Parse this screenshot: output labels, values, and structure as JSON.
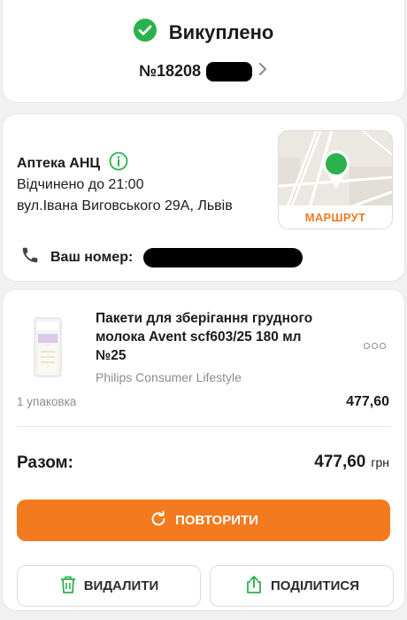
{
  "status": {
    "title": "Викуплено",
    "order_number": "№18208"
  },
  "pharmacy": {
    "name": "Аптека АНЦ",
    "hours": "Відчинено до 21:00",
    "address": "вул.Івана Виговського 29А, Львів",
    "map_route_label": "МАРШРУТ",
    "phone_label": "Ваш номер:"
  },
  "product": {
    "title": "Пакети для зберігання грудного молока Avent scf603/25 180 мл №25",
    "brand": "Philips Consumer Lifestyle",
    "quantity": "1 упаковка",
    "price": "477,60"
  },
  "total": {
    "label": "Разом:",
    "amount": "477,60",
    "currency": "грн"
  },
  "actions": {
    "repeat": "ПОВТОРИТИ",
    "delete": "ВИДАЛИТИ",
    "share": "ПОДІЛИТИСЯ"
  },
  "colors": {
    "accent": "#f37a1f",
    "success": "#2bb24c",
    "background": "#f1f1f1"
  },
  "icons": [
    "check-circle-icon",
    "chevron-right-icon",
    "info-icon",
    "map-pin-icon",
    "phone-icon",
    "more-icon",
    "refresh-icon",
    "trash-icon",
    "share-icon"
  ]
}
